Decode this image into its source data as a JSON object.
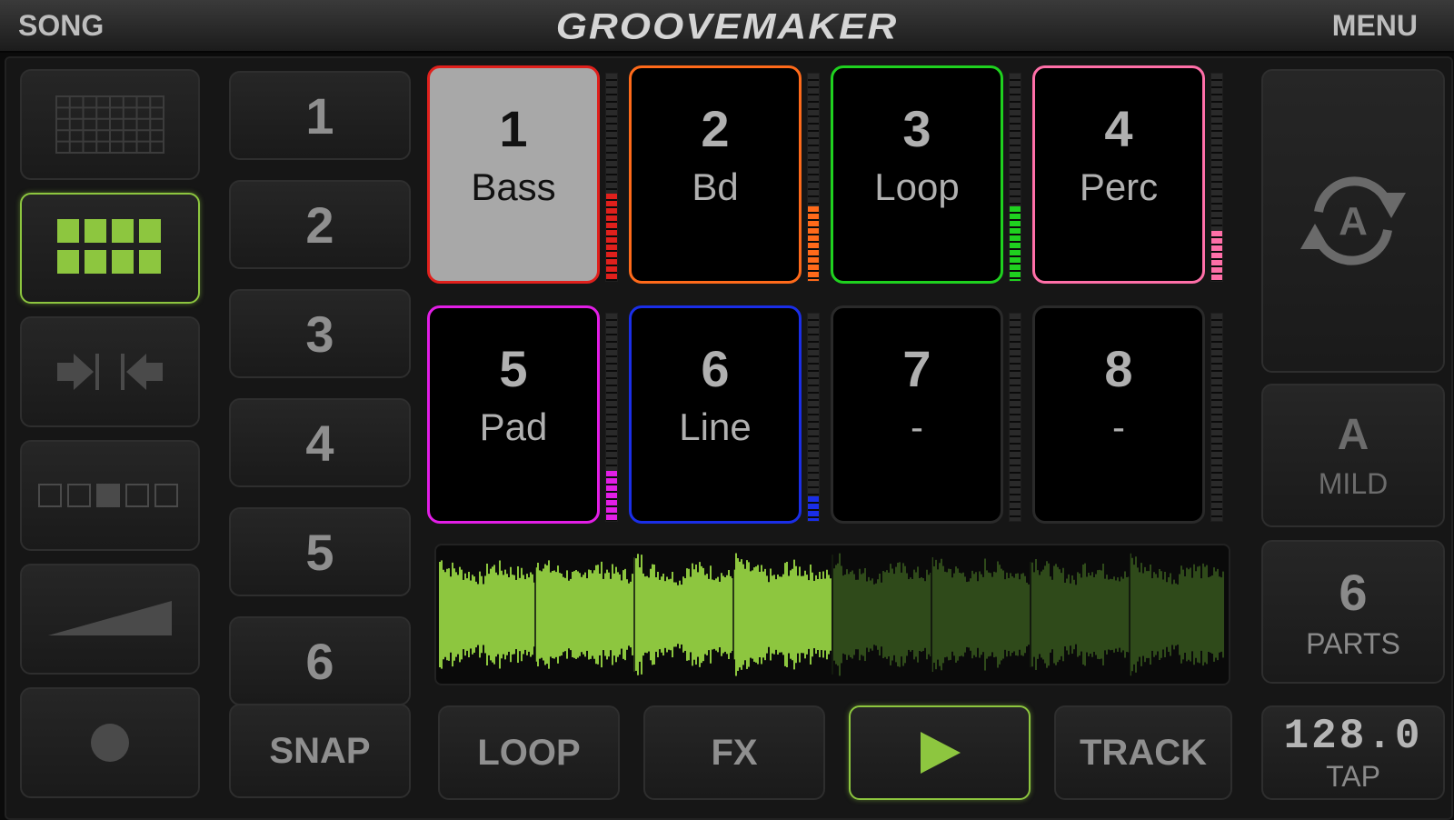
{
  "header": {
    "song_label": "SONG",
    "title": "GROOVEMAKER",
    "menu_label": "MENU"
  },
  "colors": {
    "accent": "#8dc63f",
    "active_wave": "#8dc63f",
    "inactive_wave": "#2f4a1a"
  },
  "modes": [
    {
      "icon": "grid-icon",
      "active": false
    },
    {
      "icon": "pad-grid-icon",
      "active": true
    },
    {
      "icon": "arrows-inward-icon",
      "active": false
    },
    {
      "icon": "steps-icon",
      "active": false
    },
    {
      "icon": "volume-ramp-icon",
      "active": false
    },
    {
      "icon": "record-dot-icon",
      "active": false
    }
  ],
  "parts": [
    "1",
    "2",
    "3",
    "4",
    "5",
    "6"
  ],
  "snap_label": "SNAP",
  "pads": [
    {
      "num": "1",
      "name": "Bass",
      "color": "#e0201c",
      "level": 0.42,
      "selected": true
    },
    {
      "num": "2",
      "name": "Bd",
      "color": "#ff6a1a",
      "level": 0.36,
      "selected": false
    },
    {
      "num": "3",
      "name": "Loop",
      "color": "#1fd11f",
      "level": 0.36,
      "selected": false
    },
    {
      "num": "4",
      "name": "Perc",
      "color": "#ff6fa8",
      "level": 0.24,
      "selected": false
    },
    {
      "num": "5",
      "name": "Pad",
      "color": "#e21ee6",
      "level": 0.24,
      "selected": false
    },
    {
      "num": "6",
      "name": "Line",
      "color": "#1a2ee8",
      "level": 0.12,
      "selected": false
    },
    {
      "num": "7",
      "name": "-",
      "color": "#2a2a2a",
      "level": 0,
      "selected": false
    },
    {
      "num": "8",
      "name": "-",
      "color": "#2a2a2a",
      "level": 0,
      "selected": false
    }
  ],
  "waveform": {
    "progress": 0.5,
    "segments": 8
  },
  "bottom": {
    "loop_label": "LOOP",
    "fx_label": "FX",
    "play_icon": "play-icon",
    "track_label": "TRACK"
  },
  "right": {
    "auto_icon": "auto-cycle-icon",
    "auto_letter": "A",
    "variation_letter": "A",
    "variation_label": "MILD",
    "parts_count": "6",
    "parts_label": "PARTS",
    "bpm": "128.0",
    "tap_label": "TAP"
  }
}
